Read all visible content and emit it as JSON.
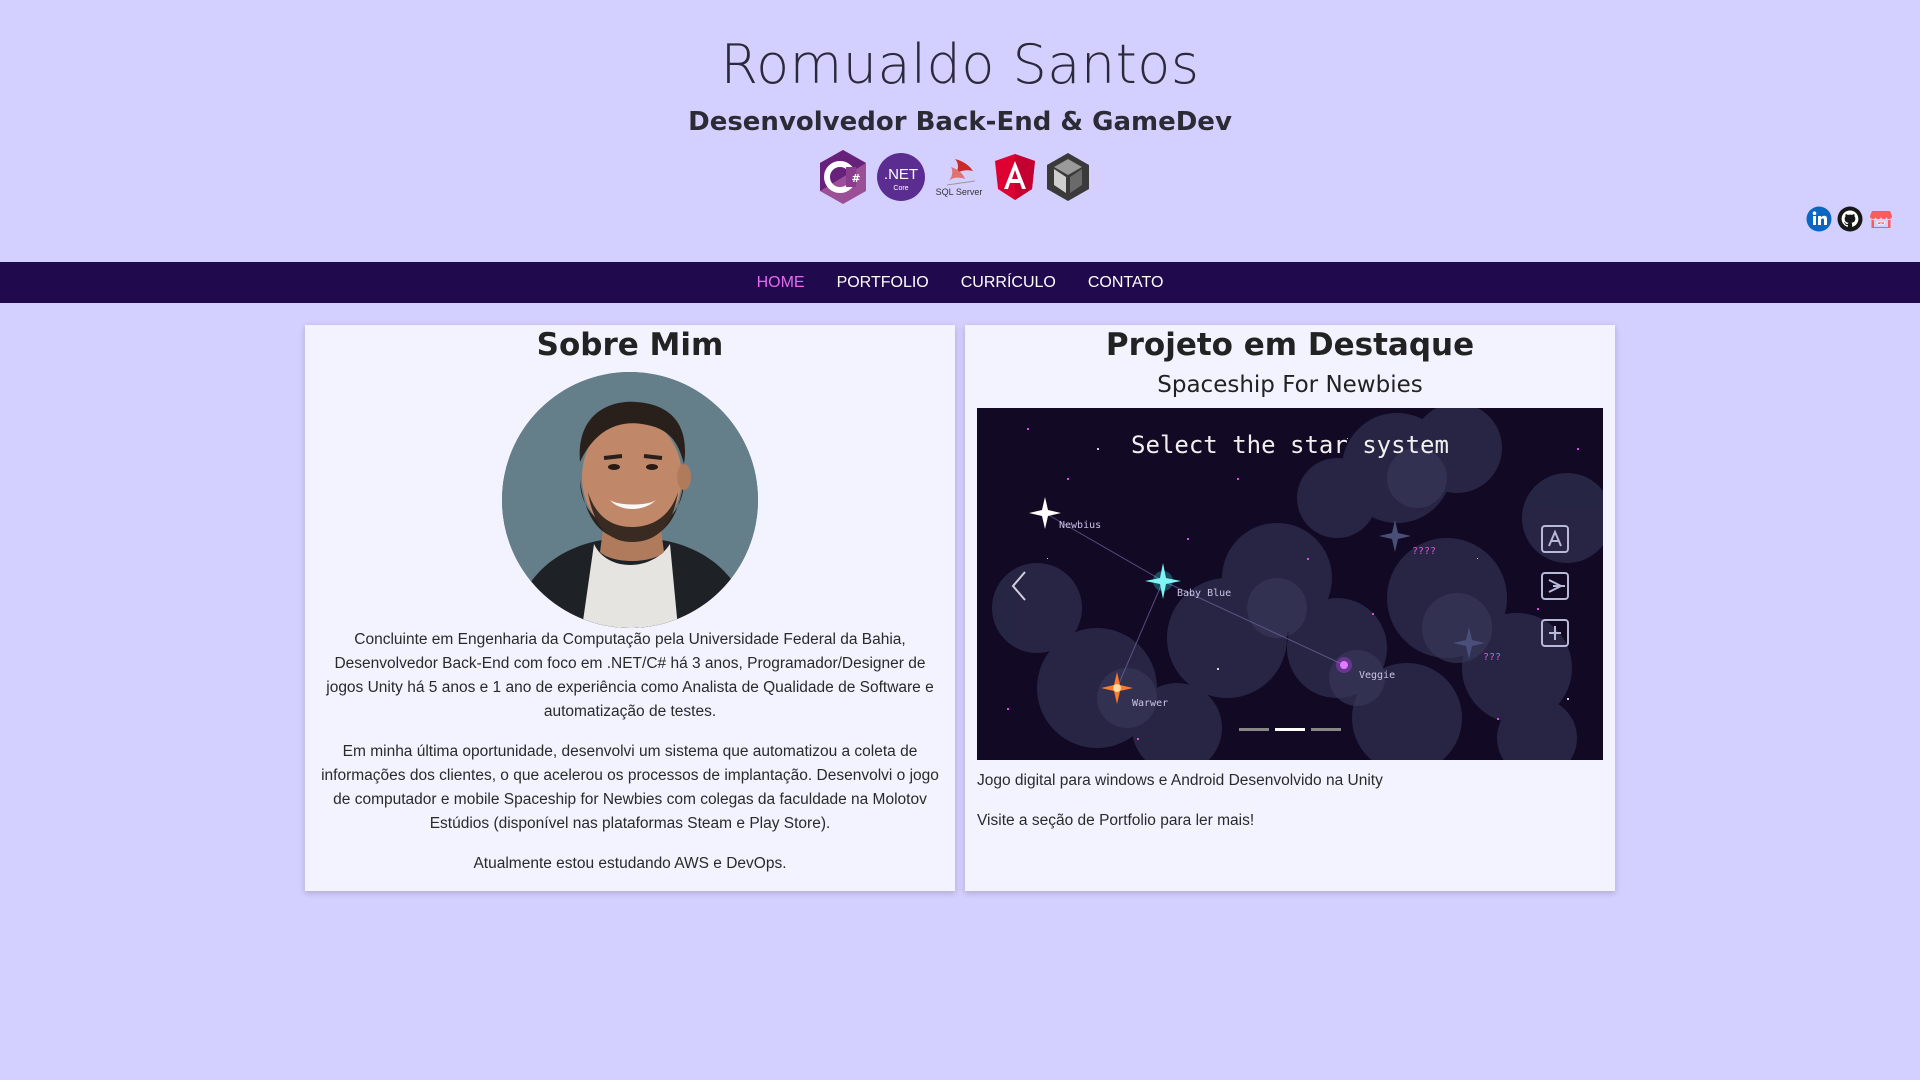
{
  "header": {
    "title": "Romualdo Santos",
    "subtitle": "Desenvolvedor Back-End & GameDev",
    "tech_icons": [
      {
        "name": "csharp-icon",
        "label": "C#",
        "color": "#68217a"
      },
      {
        "name": "dotnet-core-icon",
        "label": ".NET",
        "sublabel": "Core",
        "color": "#5c2d91"
      },
      {
        "name": "sql-server-icon",
        "label": "SQL Server",
        "color": "#cc2927"
      },
      {
        "name": "angular-icon",
        "label": "A",
        "color": "#dd0031"
      },
      {
        "name": "unity-icon",
        "label": "",
        "color": "#333333"
      }
    ],
    "social": [
      {
        "name": "linkedin-icon",
        "label": "in",
        "color": "#0a66c2"
      },
      {
        "name": "github-icon",
        "color": "#181717"
      },
      {
        "name": "itchio-icon",
        "color": "#fa5c5c"
      }
    ]
  },
  "nav": {
    "items": [
      "HOME",
      "PORTFOLIO",
      "CURRÍCULO",
      "CONTATO"
    ],
    "active": "HOME"
  },
  "about": {
    "title": "Sobre Mim",
    "paragraphs": [
      "Concluinte em Engenharia da Computação pela Universidade Federal da Bahia, Desenvolvedor Back-End com foco em .NET/C# há 3 anos, Programador/Designer de jogos Unity há 5 anos e 1 ano de experiência como Analista de Qualidade de Software e automatização de testes.",
      "Em minha última oportunidade, desenvolvi um sistema que automatizou a coleta de informações dos clientes, o que acelerou os processos de implantação. Desenvolvi o jogo de computador e mobile Spaceship for Newbies com colegas da faculdade na Molotov Estúdios (disponível nas plataformas Steam e Play Store).",
      "Atualmente estou estudando AWS e DevOps."
    ]
  },
  "featured": {
    "title": "Projeto em Destaque",
    "project_name": "Spaceship For Newbies",
    "screenshot": {
      "heading": "Select the star system",
      "stars": [
        "Newbius",
        "Baby Blue",
        "Veggie",
        "Warwer",
        "????",
        "???"
      ]
    },
    "carousel": {
      "slides": 3,
      "active_index": 1
    },
    "description": "Jogo digital para windows e Android Desenvolvido na Unity",
    "cta": "Visite a seção de Portfolio para ler mais!"
  }
}
